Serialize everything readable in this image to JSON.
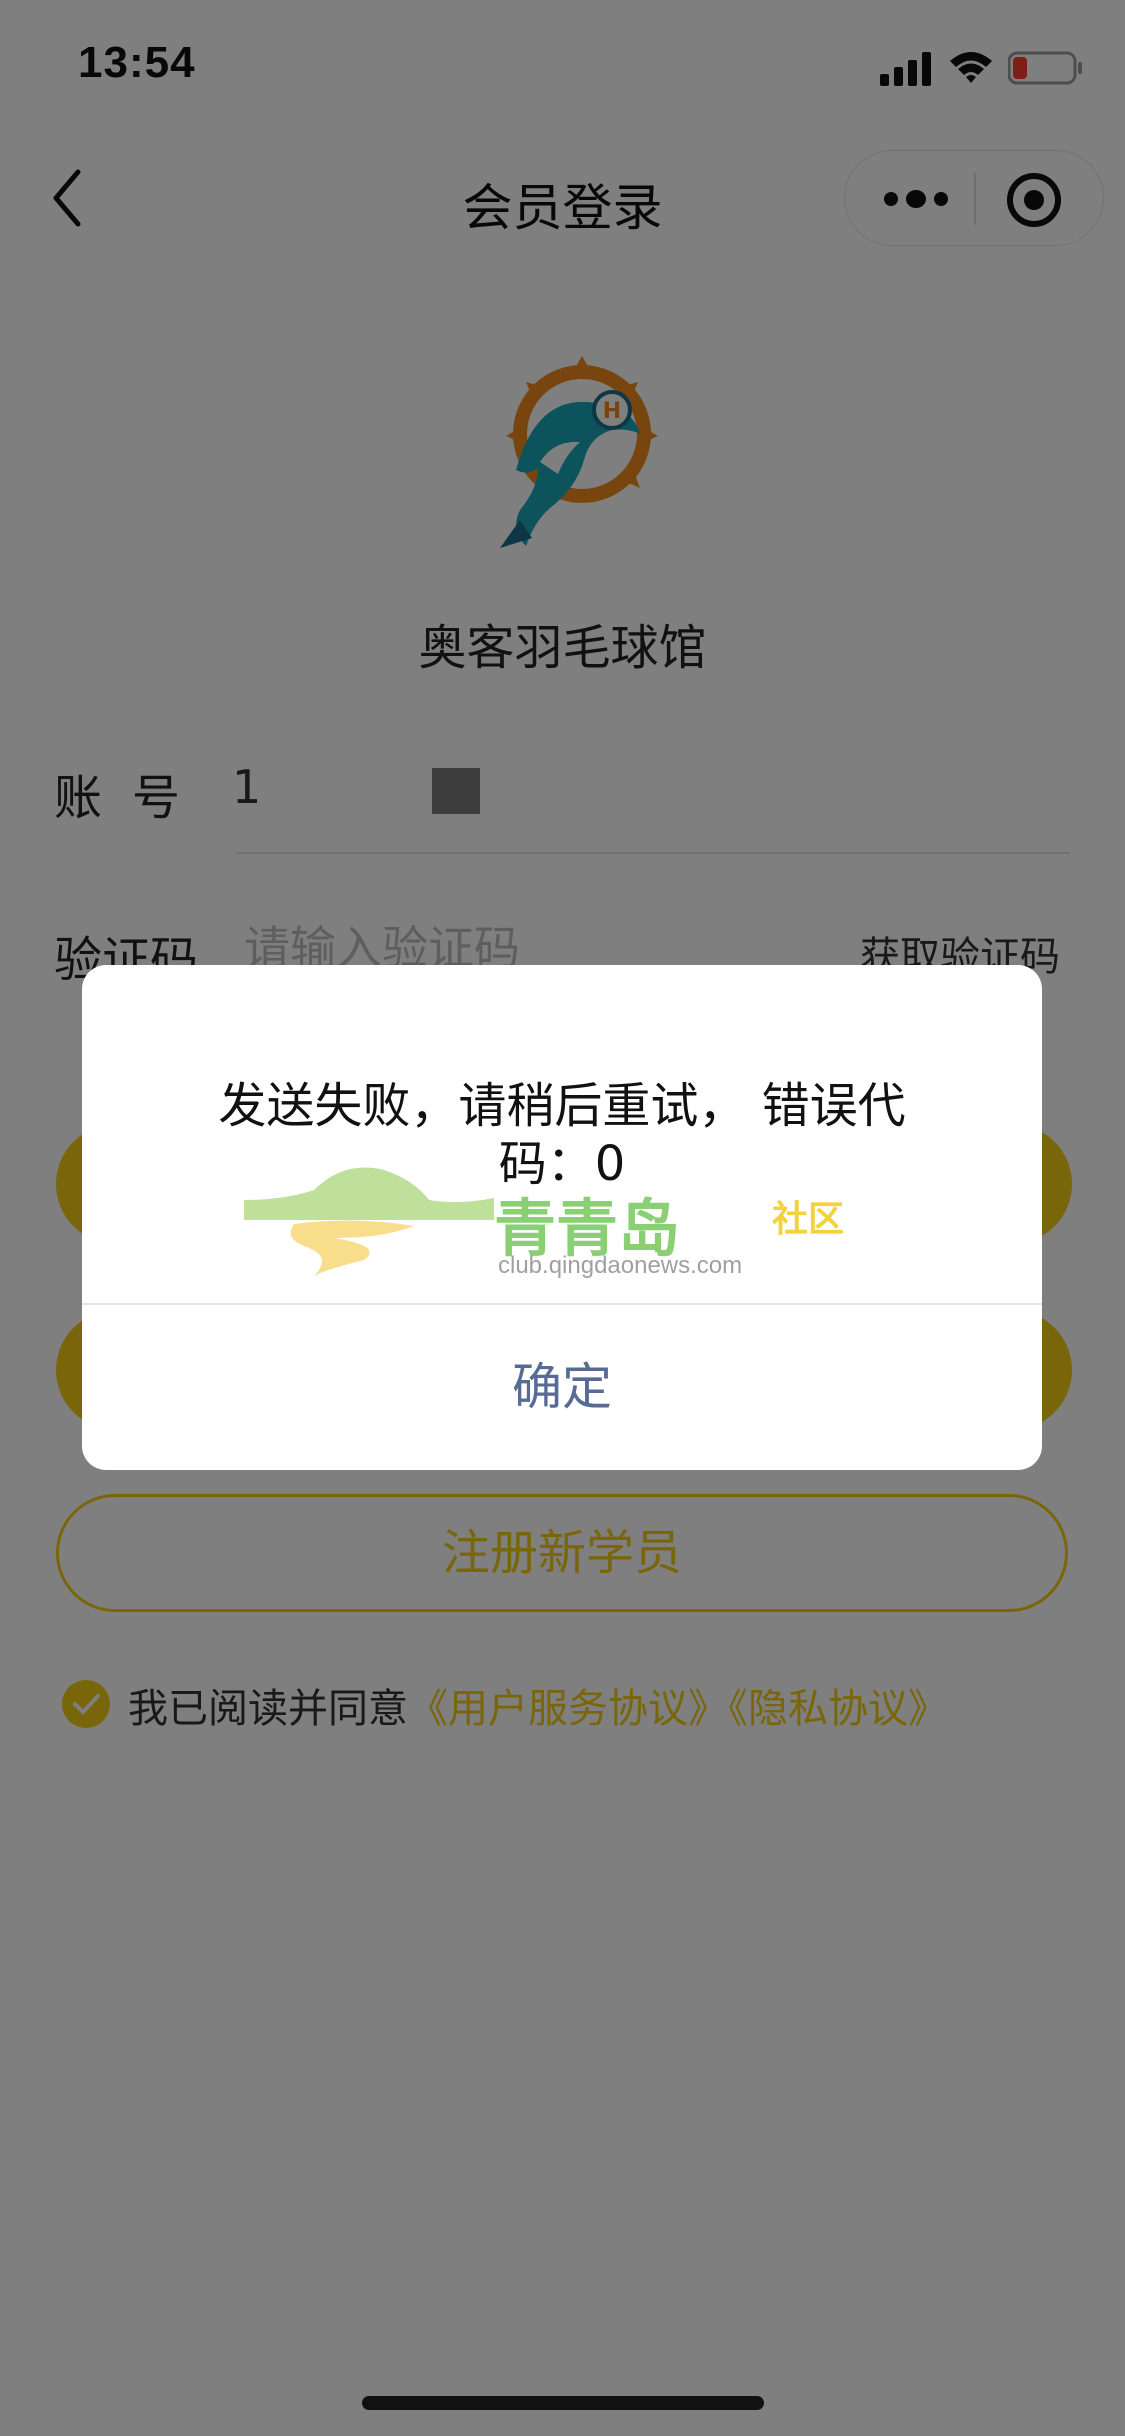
{
  "status_bar": {
    "time": "13:54"
  },
  "nav": {
    "title": "会员登录"
  },
  "venue": {
    "name": "奥客羽毛球馆"
  },
  "form": {
    "account_label": "账号",
    "account_value": "1",
    "code_label": "验证码",
    "code_placeholder": "请输入验证码",
    "get_code_label": "获取验证码"
  },
  "buttons": {
    "register_label": "注册新学员"
  },
  "agreement": {
    "prefix": "我已阅读并同意",
    "user_agreement": "《用户服务协议》",
    "privacy_agreement": "《隐私协议》"
  },
  "dialog": {
    "message": "发送失败，请稍后重试， 错误代码：0",
    "confirm_label": "确定"
  },
  "watermark": {
    "title": "青青岛",
    "tag": "社区",
    "url": "club.qingdaonews.com"
  },
  "colors": {
    "accent": "#f2cc16",
    "dialog_button": "#576b95",
    "overlay": "rgba(0,0,0,0.5)"
  },
  "icons": [
    "signal-icon",
    "wifi-icon",
    "battery-icon",
    "back-icon",
    "more-icon",
    "target-icon",
    "check-icon"
  ]
}
